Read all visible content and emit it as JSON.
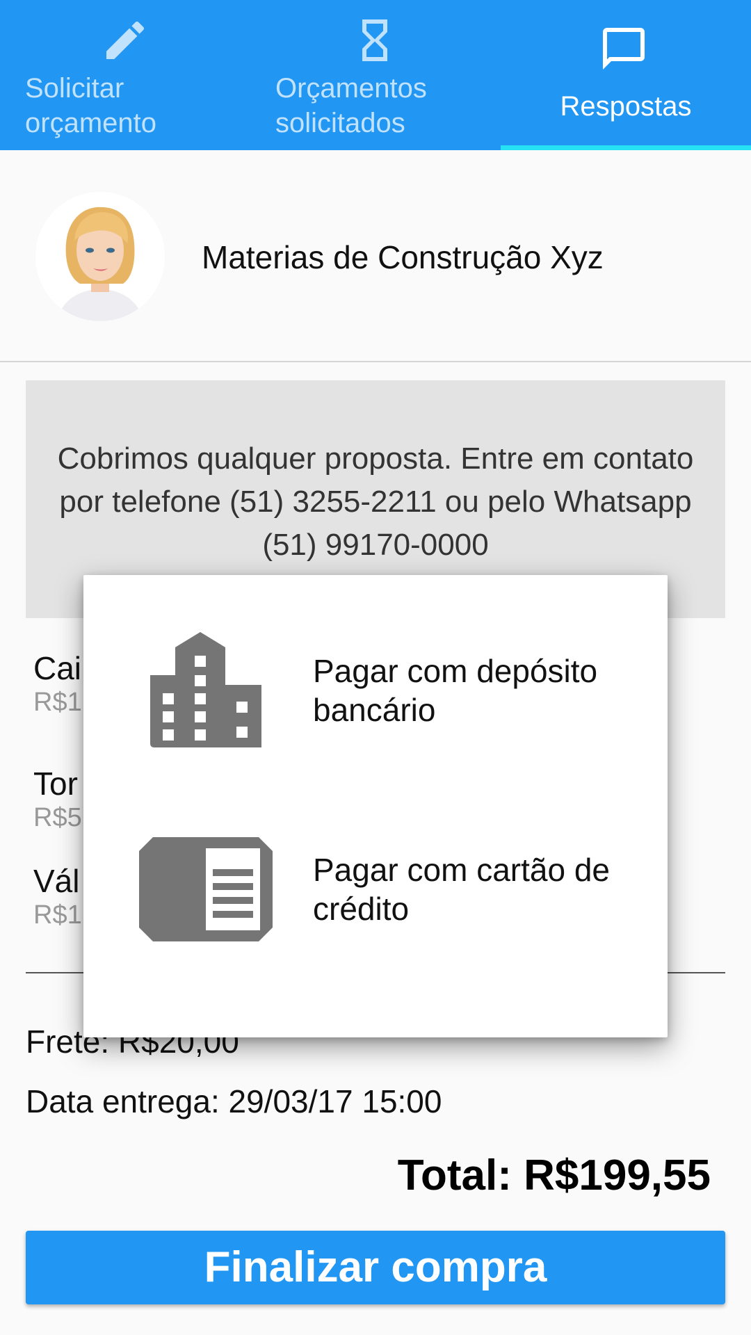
{
  "tabs": [
    {
      "label": "Solicitar\norçamento",
      "icon": "pencil-icon"
    },
    {
      "label": "Orçamentos\nsolicitados",
      "icon": "hourglass-icon"
    },
    {
      "label": "Respostas",
      "icon": "chat-bubble-icon"
    }
  ],
  "supplier": {
    "name": "Materias de Construção Xyz",
    "avatar": "supplier-avatar"
  },
  "notice": "Cobrimos qualquer proposta. Entre em contato por telefone (51) 3255-2211 ou pelo Whatsapp (51) 99170-0000",
  "items": [
    {
      "name": "Cai",
      "price": "R$1"
    },
    {
      "name": "Tor",
      "price": "R$5"
    },
    {
      "name": "Vál",
      "price": "R$1"
    }
  ],
  "summary": {
    "freight": "Frete: R$20,00",
    "delivery": "Data entrega: 29/03/17 15:00",
    "total": "Total: R$199,55"
  },
  "finalize_label": "Finalizar compra",
  "payment_dialog": {
    "options": [
      {
        "label": "Pagar com depósito bancário",
        "icon": "bank-building-icon"
      },
      {
        "label": "Pagar com cartão de crédito",
        "icon": "credit-card-icon"
      }
    ]
  },
  "colors": {
    "primary": "#2196f3",
    "tab_indicator": "#26e0f3",
    "icon_gray": "#757575",
    "notice_bg": "#e3e3e3"
  }
}
